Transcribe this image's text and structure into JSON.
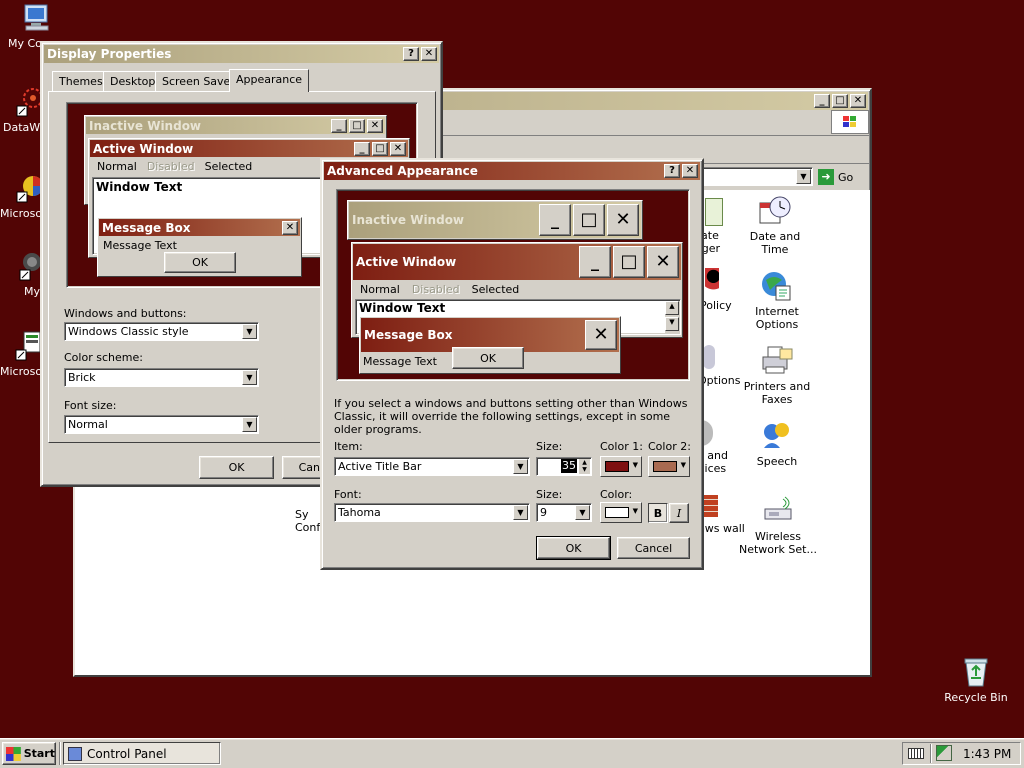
{
  "desktop": {
    "icons": [
      {
        "label": "My Co"
      },
      {
        "label": "DataW"
      },
      {
        "label": "Microso C++"
      },
      {
        "label": "My"
      },
      {
        "label": "Microso Basic"
      }
    ],
    "recycle_bin": "Recycle Bin"
  },
  "control_panel": {
    "go_label": "Go",
    "items": [
      {
        "label": "cate ager"
      },
      {
        "label": "Date and Time"
      },
      {
        "label": "Policy"
      },
      {
        "label": "Internet Options"
      },
      {
        "label": "Options"
      },
      {
        "label": "Printers and Faxes"
      },
      {
        "label": "s and vices"
      },
      {
        "label": "Speech"
      },
      {
        "label": "ows wall"
      },
      {
        "label": "Wireless Network Set..."
      },
      {
        "label": "Sy Confi"
      }
    ]
  },
  "display_properties": {
    "title": "Display Properties",
    "tabs": [
      "Themes",
      "Desktop",
      "Screen Saver",
      "Appearance"
    ],
    "preview": {
      "inactive_title": "Inactive Window",
      "active_title": "Active Window",
      "menu_normal": "Normal",
      "menu_disabled": "Disabled",
      "menu_selected": "Selected",
      "window_text": "Window Text",
      "msgbox_title": "Message Box",
      "msgbox_text": "Message Text",
      "msgbox_ok": "OK"
    },
    "windows_buttons_label": "Windows and buttons:",
    "windows_buttons_value": "Windows Classic style",
    "color_scheme_label": "Color scheme:",
    "color_scheme_value": "Brick",
    "font_size_label": "Font size:",
    "font_size_value": "Normal",
    "ok": "OK",
    "cancel": "Can"
  },
  "advanced": {
    "title": "Advanced Appearance",
    "preview": {
      "inactive_title": "Inactive Window",
      "active_title": "Active Window",
      "menu_normal": "Normal",
      "menu_disabled": "Disabled",
      "menu_selected": "Selected",
      "window_text": "Window Text",
      "msgbox_title": "Message Box",
      "msgbox_text": "Message Text",
      "msgbox_ok": "OK"
    },
    "info": "If you select a windows and buttons setting other than Windows Classic, it will override the following settings, except in some older programs.",
    "item_label": "Item:",
    "item_value": "Active Title Bar",
    "size_label": "Size:",
    "size_value": "35",
    "color1_label": "Color 1:",
    "color2_label": "Color 2:",
    "color1": "#7e1010",
    "color2": "#a86a50",
    "font_label": "Font:",
    "font_value": "Tahoma",
    "font_size_label": "Size:",
    "font_size_value": "9",
    "font_color_label": "Color:",
    "font_color": "#ffffff",
    "bold": "B",
    "italic": "I",
    "ok": "OK",
    "cancel": "Cancel"
  },
  "taskbar": {
    "start": "Start",
    "task": "Control Panel",
    "clock": "1:43 PM"
  },
  "colors": {
    "desktop": "#520505",
    "active_title_start": "#7e1e12",
    "active_title_end": "#b2704e",
    "inactive_title_start": "#aba07c",
    "inactive_title_end": "#d4cba5",
    "face": "#d4d0c8"
  }
}
